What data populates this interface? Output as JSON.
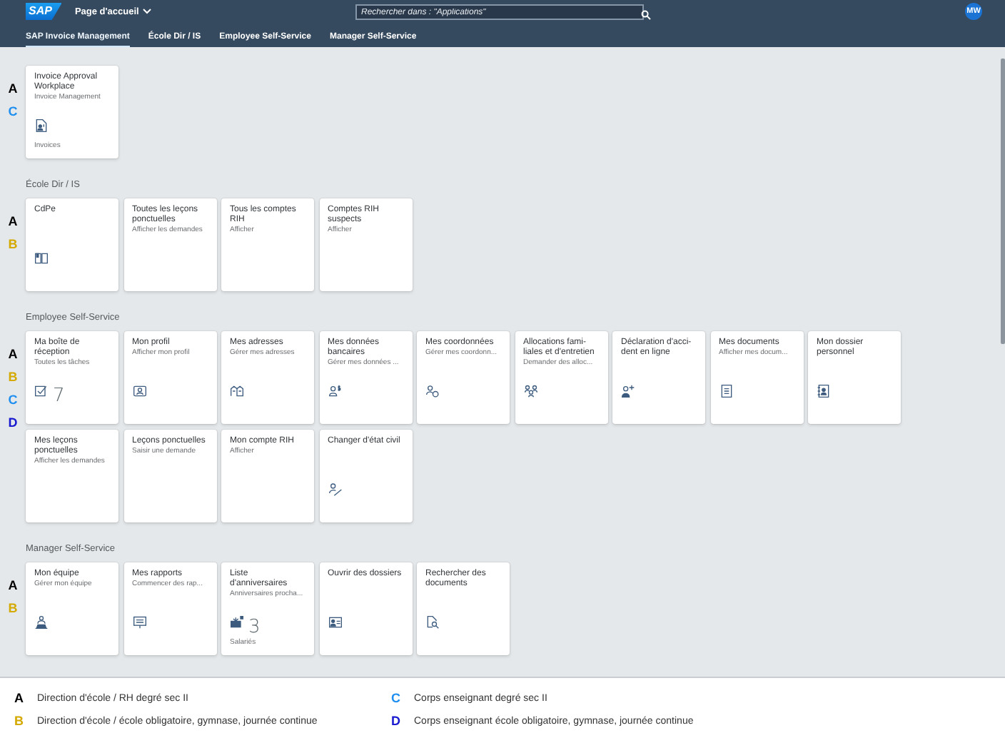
{
  "shell": {
    "logo": "SAP",
    "page_menu": "Page d'accueil",
    "search": {
      "placeholder": "Rechercher dans : \"Applications\""
    },
    "avatar": "MW"
  },
  "tabs": [
    {
      "label": "SAP Invoice Management",
      "selected": true
    },
    {
      "label": "École Dir / IS",
      "selected": false
    },
    {
      "label": "Employee Self-Service",
      "selected": false
    },
    {
      "label": "Manager Self-Service",
      "selected": false
    }
  ],
  "sections": [
    {
      "markers": [
        {
          "letter": "A",
          "color": "#000000"
        },
        {
          "letter": "C",
          "color": "#1e8ff0"
        }
      ],
      "tiles": [
        {
          "title": "Invoice Approval Workplace",
          "subtitle": "Invoice Management",
          "kind": "document-person",
          "footer": "Invoices"
        }
      ]
    },
    {
      "title": "École Dir / IS",
      "markers": [
        {
          "letter": "A",
          "color": "#000000"
        },
        {
          "letter": "B",
          "color": "#d4a900"
        }
      ],
      "tiles": [
        {
          "title": "CdPe",
          "kind": "book"
        },
        {
          "title": "Toutes les leçons ponctuelles",
          "subtitle": "Afficher les demandes"
        },
        {
          "title": "Tous les comptes RIH",
          "subtitle": "Afficher"
        },
        {
          "title": "Comptes RIH suspects",
          "subtitle": "Afficher"
        }
      ]
    },
    {
      "title": "Employee Self-Service",
      "markers": [
        {
          "letter": "A",
          "color": "#000000"
        },
        {
          "letter": "B",
          "color": "#d4a900"
        },
        {
          "letter": "C",
          "color": "#1e8ff0"
        },
        {
          "letter": "D",
          "color": "#1a1ad0"
        }
      ],
      "tiles": [
        {
          "title": "Ma boîte de réception",
          "subtitle": "Toutes les tâches",
          "kind": "task",
          "number": "7"
        },
        {
          "title": "Mon profil",
          "subtitle": "Afficher mon profil",
          "kind": "profile"
        },
        {
          "title": "Mes adresses",
          "subtitle": "Gérer mes adresses",
          "kind": "buildings"
        },
        {
          "title": "Mes données bancaires",
          "subtitle": "Gérer mes données ...",
          "kind": "person-money"
        },
        {
          "title": "Mes coordonnées",
          "subtitle": "Gérer mes coordonn...",
          "kind": "person-globe"
        },
        {
          "title": "Allocations fami-liales et d'entretien",
          "subtitle": "Demander des alloc...",
          "kind": "family"
        },
        {
          "title": "Déclaration d'acci-dent en ligne",
          "kind": "person-add"
        },
        {
          "title": "Mes documents",
          "subtitle": "Afficher mes docum...",
          "kind": "document"
        },
        {
          "title": "Mon dossier personnel",
          "kind": "contact-book"
        },
        {
          "title": "Mes leçons ponctuelles",
          "subtitle": "Afficher les demandes"
        },
        {
          "title": "Leçons ponctuelles",
          "subtitle": "Saisir une demande"
        },
        {
          "title": "Mon compte RIH",
          "subtitle": "Afficher"
        },
        {
          "title": "Changer d'état civil",
          "kind": "person-edit"
        }
      ]
    },
    {
      "title": "Manager Self-Service",
      "markers": [
        {
          "letter": "A",
          "color": "#000000"
        },
        {
          "letter": "B",
          "color": "#d4a900"
        }
      ],
      "tiles": [
        {
          "title": "Mon équipe",
          "subtitle": "Gérer mon équipe",
          "kind": "team"
        },
        {
          "title": "Mes rapports",
          "subtitle": "Commencer des rap...",
          "kind": "presentation"
        },
        {
          "title": "Liste d'anniversaires",
          "subtitle": "Anniversaires procha...",
          "kind": "gift",
          "number": "3",
          "footer": "Salariés"
        },
        {
          "title": "Ouvrir des dossiers",
          "kind": "id-card"
        },
        {
          "title": "Rechercher des documents",
          "kind": "search-document"
        }
      ]
    }
  ],
  "legend": [
    {
      "letter": "A",
      "color": "#000000",
      "text": "Direction d'école / RH degré sec II"
    },
    {
      "letter": "C",
      "color": "#1e8ff0",
      "text": "Corps enseignant degré sec II"
    },
    {
      "letter": "B",
      "color": "#d4a900",
      "text": "Direction d'école / école obligatoire, gymnase, journée continue"
    },
    {
      "letter": "D",
      "color": "#1a1ad0",
      "text": "Corps enseignant école obligatoire, gymnase, journée continue"
    }
  ]
}
